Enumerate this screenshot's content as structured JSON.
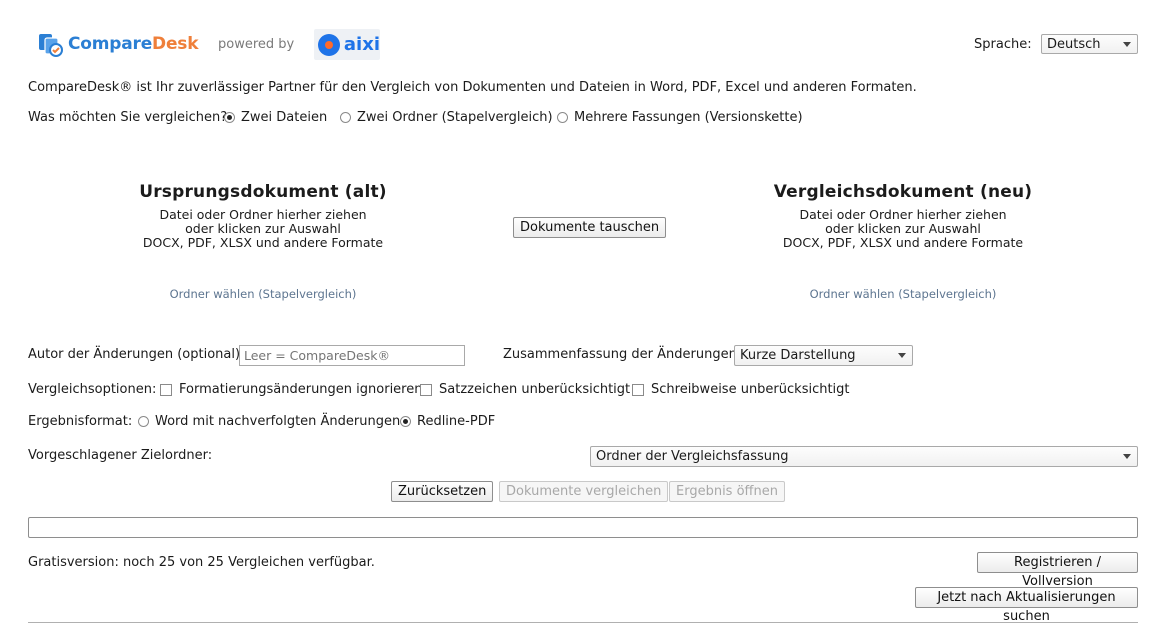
{
  "header": {
    "logo_part1": "Compare",
    "logo_part2": "Desk",
    "powered_by": "powered by",
    "partner_logo": "aixi",
    "language_label": "Sprache:",
    "language_value": "Deutsch"
  },
  "intro_text": "CompareDesk® ist Ihr zuverlässiger Partner für den Vergleich von Dokumenten und Dateien in Word, PDF, Excel und anderen Formaten.",
  "compare_mode": {
    "question": "Was möchten Sie vergleichen?",
    "options": [
      {
        "label": "Zwei Dateien",
        "selected": true
      },
      {
        "label": "Zwei Ordner (Stapelvergleich)",
        "selected": false
      },
      {
        "label": "Mehrere Fassungen (Versionskette)",
        "selected": false
      }
    ]
  },
  "source_panel": {
    "title": "Ursprungsdokument (alt)",
    "line1": "Datei oder Ordner hierher ziehen",
    "line2": "oder klicken zur Auswahl",
    "line3": "DOCX, PDF, XLSX und andere Formate",
    "folder_link": "Ordner wählen (Stapelvergleich)"
  },
  "target_panel": {
    "title": "Vergleichsdokument (neu)",
    "line1": "Datei oder Ordner hierher ziehen",
    "line2": "oder klicken zur Auswahl",
    "line3": "DOCX, PDF, XLSX und andere Formate",
    "folder_link": "Ordner wählen (Stapelvergleich)"
  },
  "swap_button": "Dokumente tauschen",
  "author": {
    "label": "Autor der Änderungen (optional):",
    "placeholder": "Leer = CompareDesk®"
  },
  "summary": {
    "label": "Zusammenfassung der Änderungen:",
    "value": "Kurze Darstellung"
  },
  "options": {
    "label": "Vergleichsoptionen:",
    "items": [
      {
        "label": "Formatierungsänderungen ignorieren",
        "checked": false
      },
      {
        "label": "Satzzeichen unberücksichtigt",
        "checked": false
      },
      {
        "label": "Schreibweise unberücksichtigt",
        "checked": false
      }
    ]
  },
  "output_format": {
    "label": "Ergebnisformat:",
    "options": [
      {
        "label": "Word mit nachverfolgten Änderungen",
        "selected": false
      },
      {
        "label": "Redline-PDF",
        "selected": true
      }
    ]
  },
  "target_folder": {
    "label": "Vorgeschlagener Zielordner:",
    "value": "Ordner der Vergleichsfassung"
  },
  "actions": {
    "reset": "Zurücksetzen",
    "compare": "Dokumente vergleichen",
    "open_result": "Ergebnis öffnen"
  },
  "progress": 0,
  "footer": {
    "status": "Gratisversion: noch 25 von 25 Vergleichen verfügbar.",
    "register": "Registrieren / Vollversion",
    "update": "Jetzt nach Aktualisierungen suchen"
  },
  "colors": {
    "logo_blue": "#2b7fd4",
    "logo_orange": "#ef7f3a",
    "link": "#5d7590"
  }
}
